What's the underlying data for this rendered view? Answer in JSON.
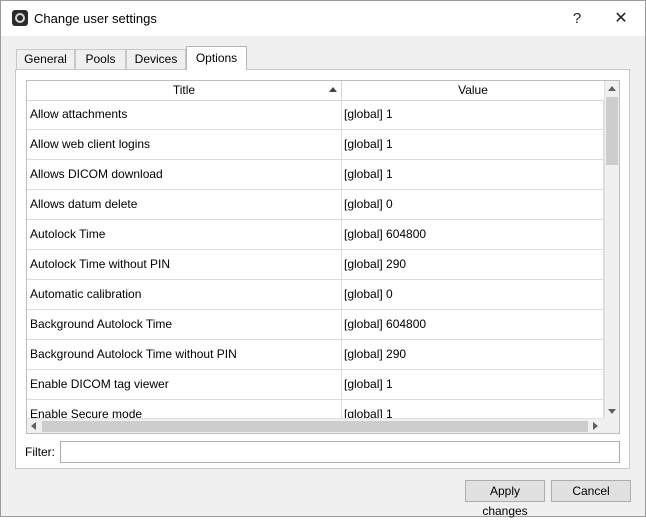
{
  "window": {
    "title": "Change user settings",
    "help_label": "?",
    "close_label": "✕"
  },
  "tabs": [
    {
      "label": "General",
      "active": false
    },
    {
      "label": "Pools",
      "active": false
    },
    {
      "label": "Devices",
      "active": false
    },
    {
      "label": "Options",
      "active": true
    }
  ],
  "table": {
    "columns": {
      "title": "Title",
      "value": "Value"
    },
    "sort": "title-ascending",
    "rows": [
      {
        "title": "Allow attachments",
        "value": "[global] 1"
      },
      {
        "title": "Allow web client logins",
        "value": "[global] 1"
      },
      {
        "title": "Allows DICOM download",
        "value": "[global] 1"
      },
      {
        "title": "Allows datum delete",
        "value": "[global] 0"
      },
      {
        "title": "Autolock Time",
        "value": "[global] 604800"
      },
      {
        "title": "Autolock Time without PIN",
        "value": "[global] 290"
      },
      {
        "title": "Automatic calibration",
        "value": "[global] 0"
      },
      {
        "title": "Background Autolock Time",
        "value": "[global] 604800"
      },
      {
        "title": "Background Autolock Time without PIN",
        "value": "[global] 290"
      },
      {
        "title": "Enable DICOM tag viewer",
        "value": "[global] 1"
      },
      {
        "title": "Enable Secure mode",
        "value": "[global] 1"
      }
    ]
  },
  "filter": {
    "label": "Filter:",
    "value": ""
  },
  "buttons": {
    "apply": "Apply changes",
    "cancel": "Cancel"
  }
}
